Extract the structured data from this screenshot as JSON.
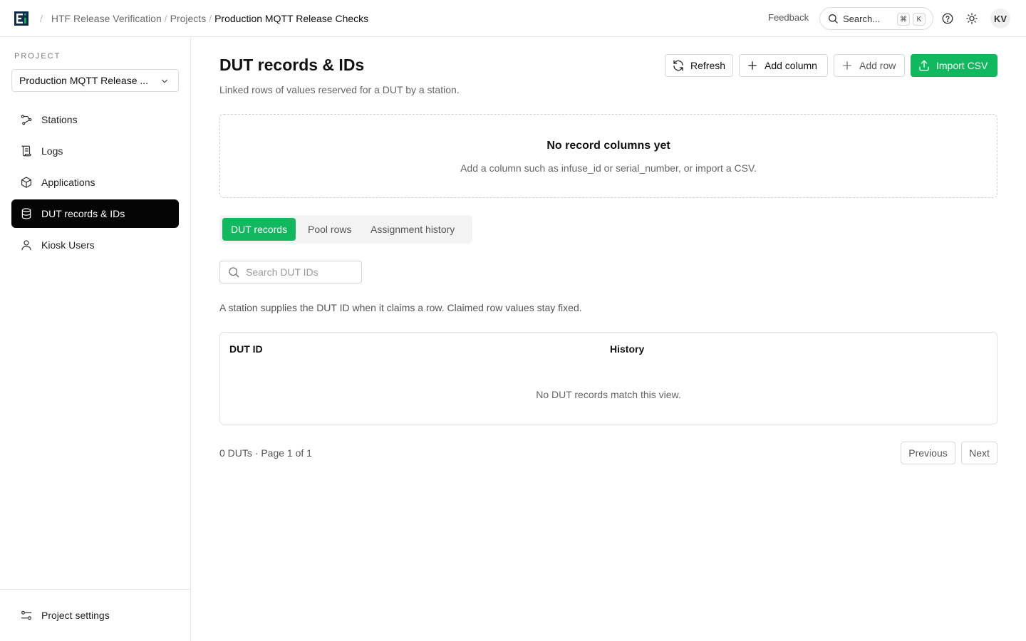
{
  "topbar": {
    "breadcrumb": [
      "HTF Release Verification",
      "Projects",
      "Production MQTT Release Checks"
    ],
    "feedback": "Feedback",
    "search_label": "Search...",
    "kbd_cmd": "⌘",
    "kbd_k": "K",
    "avatar_initials": "KV"
  },
  "sidebar": {
    "section_label": "PROJECT",
    "project_select": "Production MQTT Release ...",
    "items": [
      {
        "label": "Stations",
        "icon": "workflow-icon"
      },
      {
        "label": "Logs",
        "icon": "scroll-icon"
      },
      {
        "label": "Applications",
        "icon": "package-icon"
      },
      {
        "label": "DUT records & IDs",
        "icon": "database-icon",
        "active": true
      },
      {
        "label": "Kiosk Users",
        "icon": "user-icon"
      }
    ],
    "settings": "Project settings"
  },
  "main": {
    "title": "DUT records & IDs",
    "subtitle": "Linked rows of values reserved for a DUT by a station.",
    "buttons": {
      "refresh": "Refresh",
      "add_column": "Add column",
      "add_row": "Add row",
      "import_csv": "Import CSV"
    },
    "empty_columns": {
      "title": "No record columns yet",
      "subtitle": "Add a column such as infuse_id or serial_number, or import a CSV."
    },
    "tabs": [
      "DUT records",
      "Pool rows",
      "Assignment history"
    ],
    "search_placeholder": "Search DUT IDs",
    "hint": "A station supplies the DUT ID when it claims a row. Claimed row values stay fixed.",
    "table": {
      "columns": [
        "DUT ID",
        "History"
      ],
      "empty": "No DUT records match this view."
    },
    "pager": {
      "info": "0 DUTs · Page 1 of 1",
      "previous": "Previous",
      "next": "Next"
    }
  },
  "colors": {
    "accent": "#10b95e",
    "active_nav": "#050505"
  }
}
